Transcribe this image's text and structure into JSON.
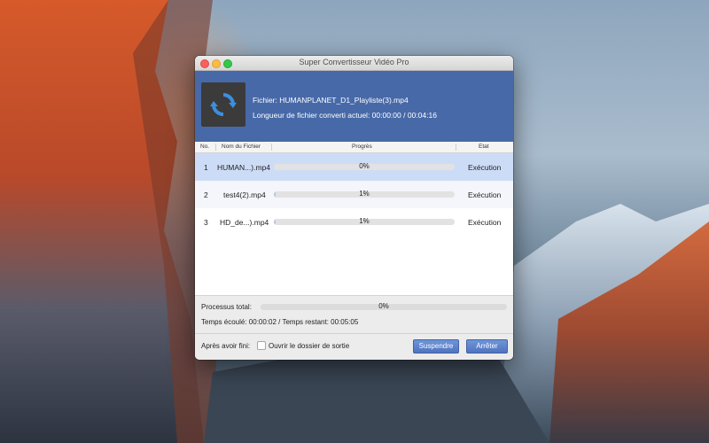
{
  "window": {
    "title": "Super Convertisseur Vidéo Pro"
  },
  "info": {
    "file_line": "Fichier: HUMANPLANET_D1_Playliste(3).mp4",
    "length_line": "Longueur de fichier converti actuel: 00:00:00 / 00:04:16",
    "thumb_icon": "convert-arrows-icon"
  },
  "table": {
    "headers": {
      "no": "No.",
      "name": "Nom du Fichier",
      "progress": "Progrès",
      "state": "Etat"
    },
    "rows": [
      {
        "no": "1",
        "name": "HUMAN...).mp4",
        "progress_label": "0%",
        "progress": 0,
        "state": "Exécution"
      },
      {
        "no": "2",
        "name": "test4(2).mp4",
        "progress_label": "1%",
        "progress": 1,
        "state": "Exécution"
      },
      {
        "no": "3",
        "name": "HD_de...).mp4",
        "progress_label": "1%",
        "progress": 1,
        "state": "Exécution"
      }
    ]
  },
  "total": {
    "label": "Processus total:",
    "percent_label": "0%",
    "percent": 0,
    "times": "Temps écoulé: 00:00:02 / Temps restant: 00:05:05"
  },
  "footer": {
    "after_label": "Après avoir fini:",
    "open_folder_label": "Ouvrir le dossier de sortie",
    "open_folder_checked": false,
    "suspend_label": "Suspendre",
    "stop_label": "Arrêter"
  },
  "colors": {
    "accent": "#4769a8",
    "selected_row": "#cddcf6",
    "button": "#5a7fcb"
  }
}
